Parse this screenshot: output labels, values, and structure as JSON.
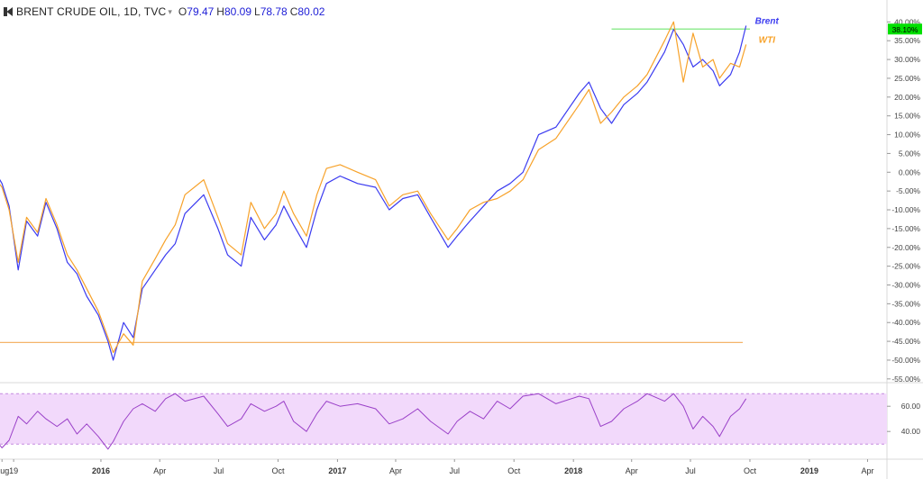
{
  "header": {
    "title": "BRENT CRUDE OIL, 1D, TVC",
    "dropdown_icon": "chevron-down-icon",
    "symbol_icon": "symbol-flag-icon",
    "ohlc": [
      {
        "key": "O",
        "value": "79.47"
      },
      {
        "key": "H",
        "value": "80.09"
      },
      {
        "key": "L",
        "value": "78.78"
      },
      {
        "key": "C",
        "value": "80.02"
      }
    ]
  },
  "chart_data": [
    {
      "type": "line",
      "panel": "price-comparison",
      "y_unit": "percent",
      "ylim": [
        -56,
        42
      ],
      "y_ticks": [
        "40.00%",
        "35.00%",
        "30.00%",
        "25.00%",
        "20.00%",
        "15.00%",
        "10.00%",
        "5.00%",
        "0.00%",
        "-5.00%",
        "-10.00%",
        "-15.00%",
        "-20.00%",
        "-25.00%",
        "-30.00%",
        "-35.00%",
        "-40.00%",
        "-45.00%",
        "-50.00%",
        "-55.00%"
      ],
      "last_value_badge": "38.10%",
      "colors": {
        "brent": "#3b3bf0",
        "wti": "#f7a22a",
        "badge": "#00e000",
        "hline_top": "#7ee87e",
        "hline_bottom": "#f4b46a"
      },
      "horizontal_lines": [
        {
          "y": 38.1,
          "x_start": "2018-03-01",
          "x_end": "2018-10-01",
          "color": "#7ee87e"
        },
        {
          "y": -45.3,
          "x_start": "2015-07-15",
          "x_end": "2018-09-20",
          "color": "#f4b46a"
        }
      ],
      "series": [
        {
          "name": "Brent",
          "color": "#3b3bf0",
          "x": [
            "2015-07-15",
            "2015-08-01",
            "2015-08-12",
            "2015-08-26",
            "2015-09-08",
            "2015-09-25",
            "2015-10-08",
            "2015-10-25",
            "2015-11-10",
            "2015-11-25",
            "2015-12-10",
            "2015-12-28",
            "2016-01-12",
            "2016-01-20",
            "2016-02-05",
            "2016-02-20",
            "2016-03-05",
            "2016-03-25",
            "2016-04-10",
            "2016-04-25",
            "2016-05-10",
            "2016-06-08",
            "2016-06-30",
            "2016-07-15",
            "2016-08-05",
            "2016-08-20",
            "2016-09-10",
            "2016-09-28",
            "2016-10-10",
            "2016-10-25",
            "2016-11-14",
            "2016-11-30",
            "2016-12-15",
            "2017-01-05",
            "2017-02-01",
            "2017-03-01",
            "2017-03-22",
            "2017-04-12",
            "2017-05-05",
            "2017-05-25",
            "2017-06-21",
            "2017-07-05",
            "2017-07-25",
            "2017-08-15",
            "2017-09-05",
            "2017-09-25",
            "2017-10-15",
            "2017-11-08",
            "2017-12-05",
            "2018-01-10",
            "2018-01-25",
            "2018-02-12",
            "2018-03-01",
            "2018-03-20",
            "2018-04-10",
            "2018-04-25",
            "2018-05-22",
            "2018-06-05",
            "2018-06-20",
            "2018-07-05",
            "2018-07-20",
            "2018-08-05",
            "2018-08-15",
            "2018-09-01",
            "2018-09-15",
            "2018-09-25"
          ],
          "values": [
            2,
            -3,
            -9,
            -26,
            -13,
            -17,
            -8,
            -15,
            -24,
            -27,
            -33,
            -38,
            -45,
            -50,
            -40,
            -44,
            -31,
            -26,
            -22,
            -19,
            -11,
            -6,
            -15,
            -22,
            -25,
            -12,
            -18,
            -14,
            -9,
            -14,
            -20,
            -10,
            -3,
            -1,
            -3,
            -4,
            -10,
            -7,
            -6,
            -12,
            -20,
            -17,
            -13,
            -9,
            -5,
            -3,
            0,
            10,
            12,
            21,
            24,
            17,
            13,
            18,
            21,
            24,
            32,
            38,
            34,
            28,
            30,
            27,
            23,
            26,
            32,
            39
          ]
        },
        {
          "name": "WTI",
          "color": "#f7a22a",
          "x": [
            "2015-07-15",
            "2015-08-01",
            "2015-08-12",
            "2015-08-26",
            "2015-09-08",
            "2015-09-25",
            "2015-10-08",
            "2015-10-25",
            "2015-11-10",
            "2015-11-25",
            "2015-12-10",
            "2015-12-28",
            "2016-01-12",
            "2016-01-20",
            "2016-02-05",
            "2016-02-20",
            "2016-03-05",
            "2016-03-25",
            "2016-04-10",
            "2016-04-25",
            "2016-05-10",
            "2016-06-08",
            "2016-06-30",
            "2016-07-15",
            "2016-08-05",
            "2016-08-20",
            "2016-09-10",
            "2016-09-28",
            "2016-10-10",
            "2016-10-25",
            "2016-11-14",
            "2016-11-30",
            "2016-12-15",
            "2017-01-05",
            "2017-02-01",
            "2017-03-01",
            "2017-03-22",
            "2017-04-12",
            "2017-05-05",
            "2017-05-25",
            "2017-06-21",
            "2017-07-05",
            "2017-07-25",
            "2017-08-15",
            "2017-09-05",
            "2017-09-25",
            "2017-10-15",
            "2017-11-08",
            "2017-12-05",
            "2018-01-10",
            "2018-01-25",
            "2018-02-12",
            "2018-03-01",
            "2018-03-20",
            "2018-04-10",
            "2018-04-25",
            "2018-05-22",
            "2018-06-05",
            "2018-06-20",
            "2018-07-05",
            "2018-07-20",
            "2018-08-05",
            "2018-08-15",
            "2018-09-01",
            "2018-09-15",
            "2018-09-25"
          ],
          "values": [
            0,
            -4,
            -10,
            -24,
            -12,
            -16,
            -7,
            -14,
            -22,
            -26,
            -31,
            -37,
            -44,
            -48,
            -43,
            -46,
            -29,
            -23,
            -18,
            -14,
            -6,
            -2,
            -12,
            -19,
            -22,
            -8,
            -15,
            -11,
            -5,
            -11,
            -17,
            -6,
            1,
            2,
            0,
            -2,
            -9,
            -6,
            -5,
            -11,
            -18,
            -15,
            -10,
            -8,
            -7,
            -5,
            -2,
            6,
            9,
            18,
            22,
            13,
            16,
            20,
            23,
            26,
            35,
            40,
            24,
            37,
            28,
            30,
            25,
            29,
            28,
            34
          ]
        }
      ],
      "series_labels": [
        {
          "text": "Brent",
          "color": "#3b3bf0"
        },
        {
          "text": "WTI",
          "color": "#f7a22a"
        }
      ]
    },
    {
      "type": "line",
      "panel": "oscillator",
      "ylim": [
        18,
        78
      ],
      "y_ticks": [
        "60.00",
        "40.00"
      ],
      "band": [
        30,
        70
      ],
      "colors": {
        "line": "#9a40c8",
        "band": "#f2d9fb",
        "band_edge": "#c58be0"
      },
      "series": [
        {
          "x": [
            "2015-07-15",
            "2015-08-01",
            "2015-08-12",
            "2015-08-26",
            "2015-09-08",
            "2015-09-25",
            "2015-10-08",
            "2015-10-25",
            "2015-11-10",
            "2015-11-25",
            "2015-12-10",
            "2015-12-28",
            "2016-01-12",
            "2016-01-20",
            "2016-02-05",
            "2016-02-20",
            "2016-03-05",
            "2016-03-25",
            "2016-04-10",
            "2016-04-25",
            "2016-05-10",
            "2016-06-08",
            "2016-06-30",
            "2016-07-15",
            "2016-08-05",
            "2016-08-20",
            "2016-09-10",
            "2016-09-28",
            "2016-10-10",
            "2016-10-25",
            "2016-11-14",
            "2016-11-30",
            "2016-12-15",
            "2017-01-05",
            "2017-02-01",
            "2017-03-01",
            "2017-03-22",
            "2017-04-12",
            "2017-05-05",
            "2017-05-25",
            "2017-06-21",
            "2017-07-05",
            "2017-07-25",
            "2017-08-15",
            "2017-09-05",
            "2017-09-25",
            "2017-10-15",
            "2017-11-08",
            "2017-12-05",
            "2018-01-10",
            "2018-01-25",
            "2018-02-12",
            "2018-03-01",
            "2018-03-20",
            "2018-04-10",
            "2018-04-25",
            "2018-05-22",
            "2018-06-05",
            "2018-06-20",
            "2018-07-05",
            "2018-07-20",
            "2018-08-05",
            "2018-08-15",
            "2018-09-01",
            "2018-09-15",
            "2018-09-25"
          ],
          "values": [
            38,
            27,
            33,
            52,
            46,
            56,
            50,
            44,
            50,
            38,
            46,
            36,
            26,
            32,
            48,
            58,
            62,
            56,
            66,
            70,
            64,
            68,
            54,
            44,
            50,
            62,
            56,
            60,
            64,
            48,
            40,
            54,
            64,
            60,
            62,
            58,
            46,
            50,
            58,
            48,
            38,
            48,
            56,
            50,
            64,
            58,
            68,
            70,
            62,
            68,
            66,
            44,
            48,
            58,
            64,
            70,
            64,
            70,
            60,
            42,
            52,
            44,
            36,
            52,
            58,
            66
          ]
        }
      ]
    }
  ],
  "x_axis": {
    "ticks": [
      "Aug",
      "19",
      "2016",
      "Apr",
      "Jul",
      "Oct",
      "2017",
      "Apr",
      "Jul",
      "Oct",
      "2018",
      "Apr",
      "Jul",
      "Oct",
      "2019",
      "Apr"
    ],
    "bold": [
      "2016",
      "2017",
      "2018",
      "2019"
    ]
  }
}
